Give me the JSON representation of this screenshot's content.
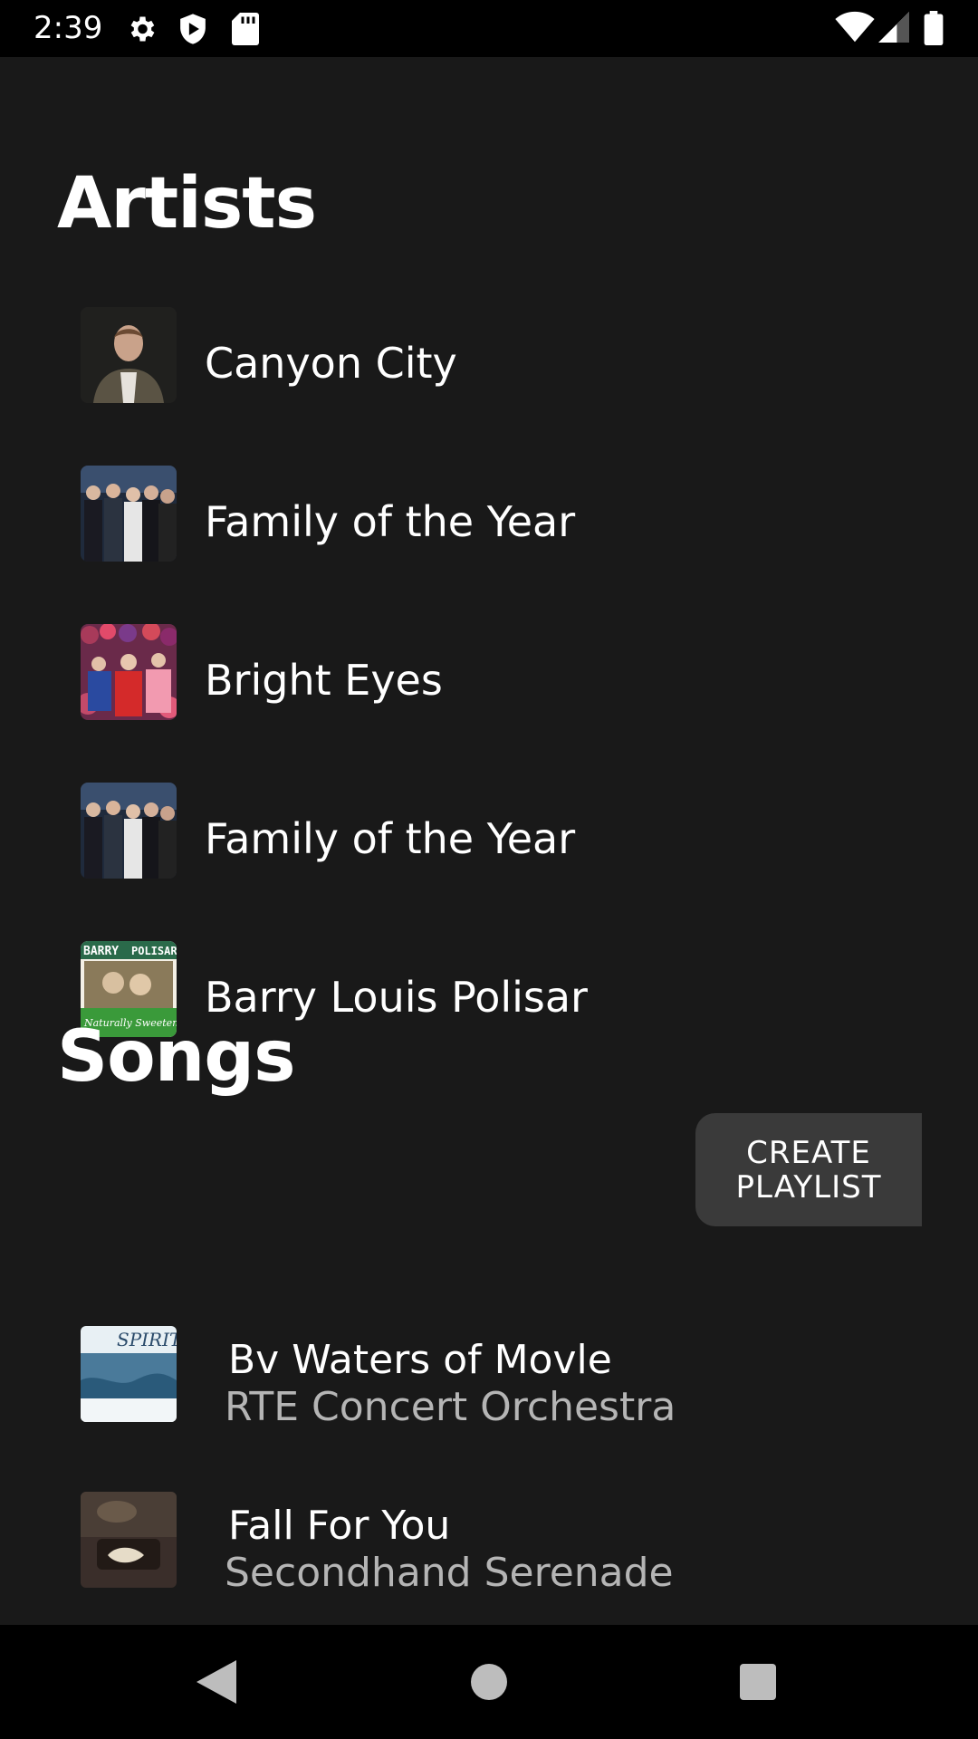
{
  "status_bar": {
    "time": "2:39",
    "left_icons": [
      "settings-icon",
      "shield-icon",
      "sd-card-icon"
    ],
    "right_icons": [
      "wifi-icon",
      "cell-signal-icon",
      "battery-icon"
    ]
  },
  "artists_section": {
    "title": "Artists",
    "items": [
      {
        "name": "Canyon City",
        "thumb": "canyon-city-thumb"
      },
      {
        "name": "Family of the Year",
        "thumb": "family-of-the-year-thumb"
      },
      {
        "name": "Bright Eyes",
        "thumb": "bright-eyes-thumb"
      },
      {
        "name": "Family of the Year",
        "thumb": "family-of-the-year-thumb"
      },
      {
        "name": "Barry Louis Polisar",
        "thumb": "barry-louis-polisar-thumb"
      }
    ]
  },
  "songs_section": {
    "title": "Songs",
    "create_button_line1": "CREATE",
    "create_button_line2": "PLAYLIST",
    "items": [
      {
        "title": "Bv Waters of Movle",
        "artist": "RTE Concert Orchestra",
        "thumb": "spirit-album-thumb"
      },
      {
        "title": "Fall For You",
        "artist": "Secondhand Serenade",
        "thumb": "secondhand-serenade-album-thumb"
      }
    ]
  },
  "album_art_text": {
    "barry_top": "BARRY",
    "barry_top_right": "POLISAR",
    "barry_bottom": "Naturally Sweetened",
    "spirit_title": "SPIRIT"
  },
  "nav_bar": {
    "buttons": [
      "back-icon",
      "home-icon",
      "recents-icon"
    ]
  },
  "colors": {
    "background": "#191919",
    "status_bar": "#000000",
    "button_bg": "#3a3a3a",
    "secondary_text": "#b5b5b5"
  }
}
